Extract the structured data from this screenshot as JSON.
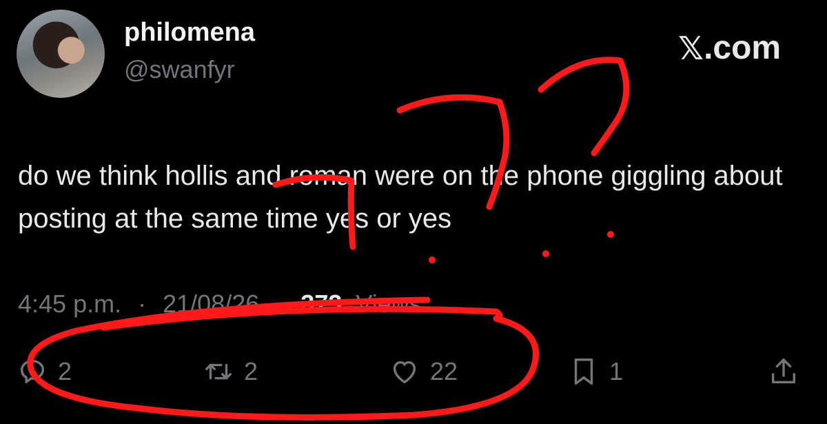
{
  "author": {
    "display_name": "philomena",
    "handle": "@swanfyr"
  },
  "brand": {
    "logo_text": ".com",
    "logo_glyph": "𝕏"
  },
  "tweet": {
    "text": "do we think hollis and roman were on the phone giggling about posting at the same time yes or yes"
  },
  "meta": {
    "time": "4:45 p.m.",
    "separator": "·",
    "date": "21/08/26",
    "views_count": "373",
    "views_label": "Views"
  },
  "actions": {
    "reply_count": "2",
    "retweet_count": "2",
    "like_count": "22",
    "bookmark_count": "1"
  },
  "annotation": {
    "color": "#ff1a1a"
  },
  "colors": {
    "background": "#000000",
    "text": "#e7e9ea",
    "muted": "#71767b"
  }
}
